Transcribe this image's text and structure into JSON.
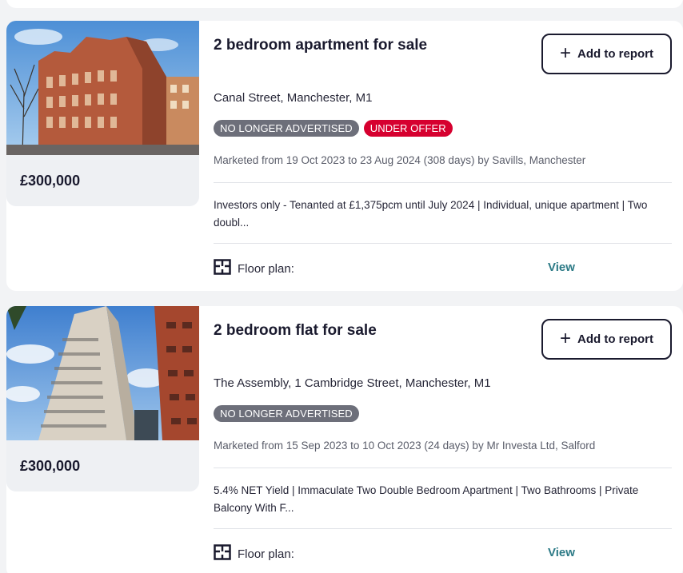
{
  "listings": [
    {
      "title": "2 bedroom apartment for sale",
      "add_label": "Add to report",
      "address": "Canal Street, Manchester, M1",
      "badges": [
        "NO LONGER ADVERTISED",
        "UNDER OFFER"
      ],
      "marketed": "Marketed from 19 Oct 2023 to 23 Aug 2024 (308 days) by Savills, Manchester",
      "description": "Investors only - Tenanted at £1,375pcm until July 2024 | Individual, unique apartment | Two doubl...",
      "floor_label": "Floor plan:",
      "view_label": "View",
      "price": "£300,000"
    },
    {
      "title": "2 bedroom flat for sale",
      "add_label": "Add to report",
      "address": "The Assembly, 1 Cambridge Street, Manchester, M1",
      "badges": [
        "NO LONGER ADVERTISED"
      ],
      "marketed": "Marketed from 15 Sep 2023 to 10 Oct 2023 (24 days) by Mr Investa Ltd, Salford",
      "description": "5.4% NET Yield | Immaculate Two Double Bedroom Apartment | Two Bathrooms | Private Balcony With F...",
      "floor_label": "Floor plan:",
      "view_label": "View",
      "price": "£300,000"
    }
  ],
  "colors": {
    "badge_grey": "#6d6f7a",
    "badge_red": "#d6002f",
    "link": "#2c7a86",
    "text": "#1a1a2e"
  },
  "icons": [
    "plus-icon",
    "floor-plan-icon"
  ]
}
